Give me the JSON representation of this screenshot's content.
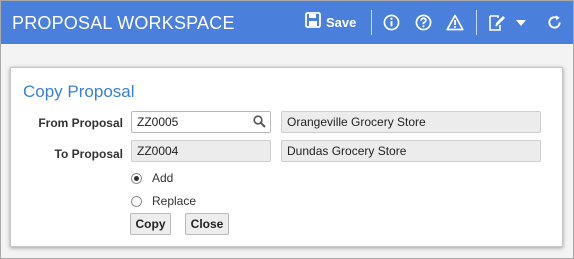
{
  "header": {
    "title": "PROPOSAL WORKSPACE",
    "save_label": "Save",
    "icons": [
      "save-icon",
      "info-icon",
      "help-icon",
      "warning-icon",
      "note-edit-icon",
      "dropdown-caret-icon",
      "refresh-icon"
    ]
  },
  "dialog": {
    "title": "Copy Proposal",
    "from_proposal": {
      "label": "From Proposal",
      "value": "ZZ0005",
      "description": "Orangeville Grocery Store"
    },
    "to_proposal": {
      "label": "To Proposal",
      "value": "ZZ0004",
      "description": "Dundas Grocery Store"
    },
    "options": [
      {
        "label": "Add",
        "selected": true
      },
      {
        "label": "Replace",
        "selected": false
      }
    ],
    "copy_label": "Copy",
    "close_label": "Close"
  },
  "colors": {
    "header_bg": "#4a7fdc",
    "title_blue": "#3a7fd6"
  }
}
